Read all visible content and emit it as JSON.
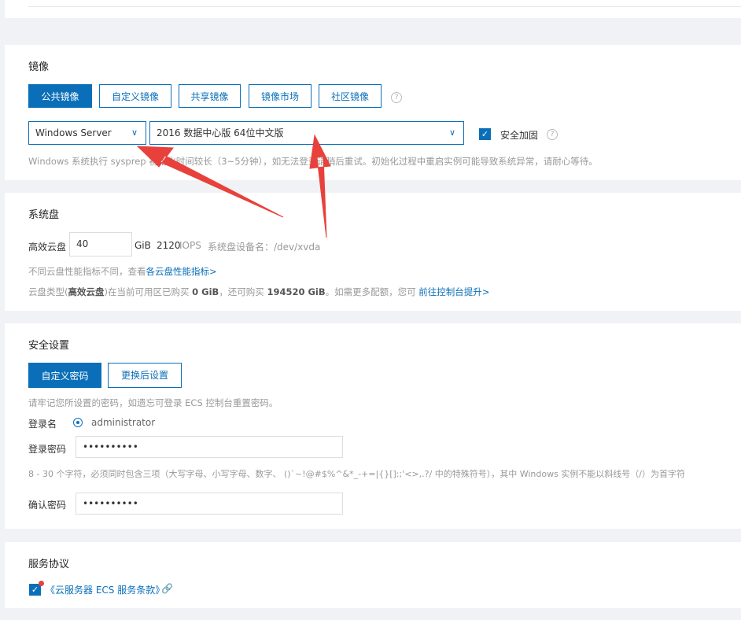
{
  "image": {
    "title": "镜像",
    "tabs": [
      "公共镜像",
      "自定义镜像",
      "共享镜像",
      "镜像市场",
      "社区镜像"
    ],
    "os_select": "Windows Server",
    "version_select": "2016 数据中心版 64位中文版",
    "security_label": "安全加固",
    "hint": "Windows 系统执行 sysprep 初始化时间较长（3~5分钟），如无法登录请稍后重试。初始化过程中重启实例可能导致系统异常，请耐心等待。"
  },
  "disk": {
    "title": "系统盘",
    "type_label": "高效云盘",
    "size_value": "40",
    "unit": "GiB",
    "iops_value": "2120",
    "iops_unit": "IOPS",
    "device_text": "系统盘设备名：/dev/xvda",
    "perf_text": "不同云盘性能指标不同，查看",
    "perf_link": "各云盘性能指标>",
    "quota_pre": "云盘类型(",
    "quota_type": "高效云盘",
    "quota_mid1": ")在当前可用区已购买",
    "quota_bought": "0 GiB",
    "quota_mid2": "，还可购买",
    "quota_left": "194520 GiB",
    "quota_mid3": "。如需更多配额，您可",
    "quota_link": "前往控制台提升>"
  },
  "security": {
    "title": "安全设置",
    "tabs": [
      "自定义密码",
      "更换后设置"
    ],
    "remember_hint": "请牢记您所设置的密码，如遗忘可登录 ECS 控制台重置密码。",
    "login_label": "登录名",
    "login_value": "administrator",
    "password_label": "登录密码",
    "password_value": "••••••••••",
    "rule_hint": "8 - 30 个字符，必须同时包含三项（大写字母、小写字母、数字、 ()`~!@#$%^&*_-+=|{}[]:;'<>,.?/ 中的特殊符号），其中 Windows 实例不能以斜线号（/）为首字符",
    "confirm_label": "确认密码",
    "confirm_value": "••••••••••"
  },
  "agreement": {
    "title": "服务协议",
    "link": "《云服务器 ECS 服务条款》"
  },
  "colors": {
    "accent": "#0a6fb8",
    "annotation_arrow": "#e8413c"
  }
}
